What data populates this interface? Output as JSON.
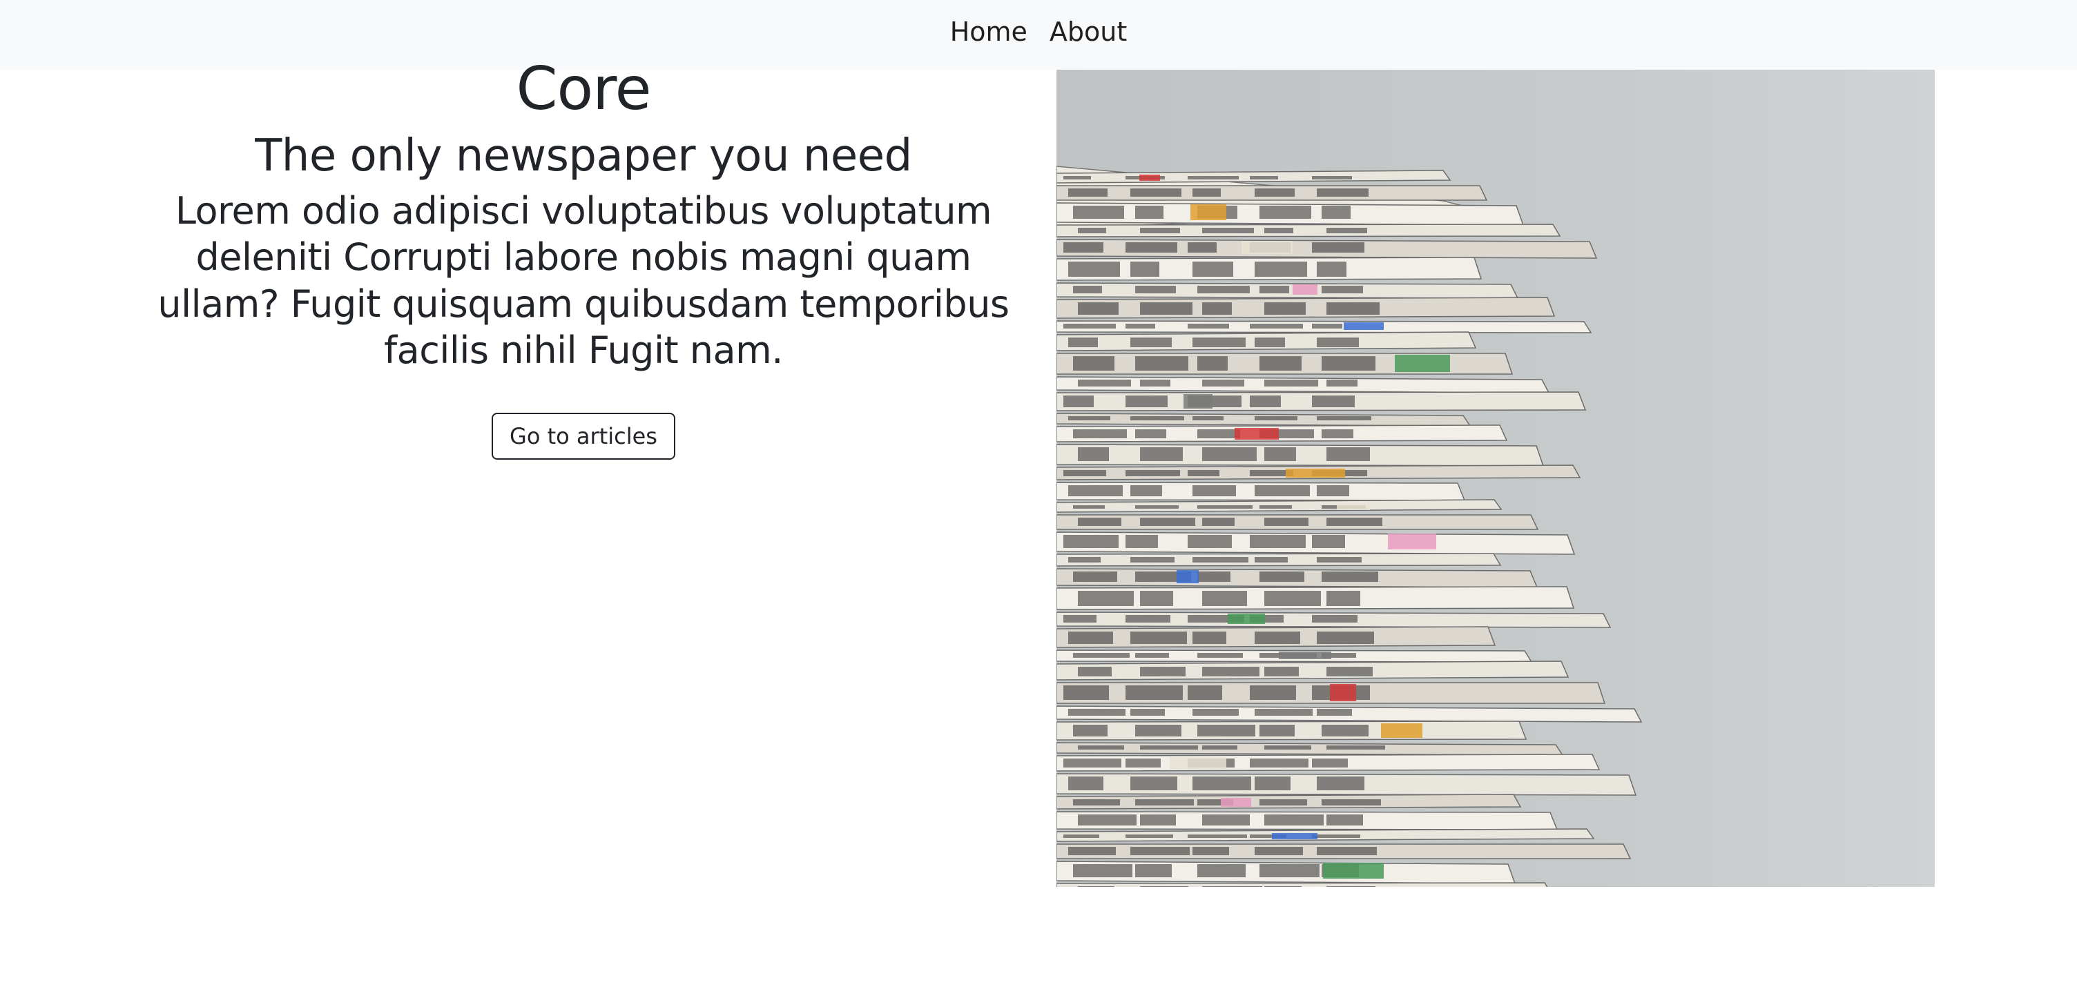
{
  "nav": {
    "items": [
      {
        "label": "Home"
      },
      {
        "label": "About"
      }
    ]
  },
  "hero": {
    "title": "Core",
    "tagline": "The only newspaper you need",
    "description": "Lorem odio adipisci voluptatibus voluptatum deleniti Corrupti labore nobis magni quam ullam? Fugit quisquam quibusdam temporibus facilis nihil Fugit nam.",
    "button_label": "Go to articles"
  },
  "image": {
    "icon": "newspaper-stack-photo"
  }
}
